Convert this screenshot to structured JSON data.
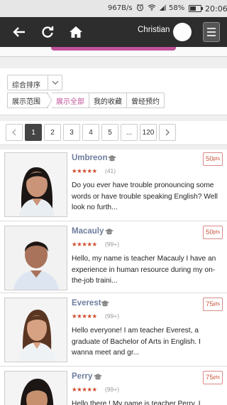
{
  "status_bar": {
    "speed": "967B/s",
    "alarm_icon": "alarm-icon",
    "wifi_icon": "wifi-icon",
    "signal_icon": "signal-icon",
    "battery_percent": "58%",
    "battery_level": 0.58,
    "time": "20:06"
  },
  "topnav": {
    "username": "Christian"
  },
  "filter": {
    "sort_label": "综合排序",
    "tabs": [
      "展示范围",
      "展示全部",
      "我的收藏",
      "曾经预约"
    ],
    "active_tab": "展示全部"
  },
  "pagination": {
    "prev": "<",
    "pages": [
      "1",
      "2",
      "3",
      "4",
      "5",
      "...",
      "120"
    ],
    "next": ">",
    "current": "1"
  },
  "teachers": [
    {
      "name": "Umbreon",
      "rating_stars": "★★★★★",
      "rating_value": 5,
      "review_count": "(41)",
      "price": "50",
      "price_unit": "pts",
      "bio": "Do you ever have trouble pronouncing some words or have trouble speaking English? Well look no furth..."
    },
    {
      "name": "Macauly",
      "rating_stars": "★★★★★",
      "rating_value": 5,
      "review_count": "(99+)",
      "price": "50",
      "price_unit": "pts",
      "bio": "Hello, my name is teacher Macauly I have an experience in human resource during my on-the-job traini..."
    },
    {
      "name": "Everest",
      "rating_stars": "★★★★★",
      "rating_value": 5,
      "review_count": "(99+)",
      "price": "75",
      "price_unit": "pts",
      "bio": "Hello everyone! I am teacher Everest, a graduate of Bachelor of Arts in English. I wanna meet and gr..."
    },
    {
      "name": "Perry",
      "rating_stars": "★★★★★",
      "rating_value": 5,
      "review_count": "(99+)",
      "price": "75",
      "price_unit": "pts",
      "bio": "Hello there ! My name is teacher Perry. I"
    }
  ],
  "colors": {
    "accent_pink": "#c0529a",
    "nav_bg": "#2d2d2d",
    "name_color": "#6f7e9e",
    "star_color": "#d14b2c",
    "price_color": "#c9553b"
  }
}
